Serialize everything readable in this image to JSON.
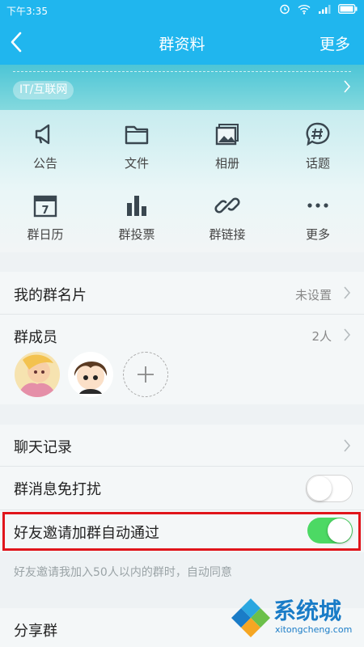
{
  "status_bar": {
    "time": "下午3:35",
    "battery_icon": "battery-icon"
  },
  "nav": {
    "title": "群资料",
    "more": "更多"
  },
  "banner": {
    "tag": "IT/互联网"
  },
  "features": [
    {
      "label": "公告",
      "icon": "megaphone-icon"
    },
    {
      "label": "文件",
      "icon": "folder-icon"
    },
    {
      "label": "相册",
      "icon": "photo-album-icon"
    },
    {
      "label": "话题",
      "icon": "topic-icon"
    },
    {
      "label": "群日历",
      "icon": "calendar-icon"
    },
    {
      "label": "群投票",
      "icon": "vote-icon"
    },
    {
      "label": "群链接",
      "icon": "link-icon"
    },
    {
      "label": "更多",
      "icon": "more-dots-icon"
    }
  ],
  "calendar_day": "7",
  "card": {
    "label": "我的群名片",
    "value": "未设置"
  },
  "members": {
    "label": "群成员",
    "count": "2人"
  },
  "chat_history": {
    "label": "聊天记录"
  },
  "mute": {
    "label": "群消息免打扰",
    "on": false
  },
  "auto_accept": {
    "label": "好友邀请加群自动通过",
    "on": true
  },
  "hint": "好友邀请我加入50人以内的群时，自动同意",
  "share": {
    "label": "分享群"
  },
  "watermark": {
    "name": "系统城",
    "site": "xitongcheng.com"
  },
  "colors": {
    "accent": "#20b6ee",
    "toggle_on": "#4cd964",
    "highlight": "#e0151b"
  }
}
